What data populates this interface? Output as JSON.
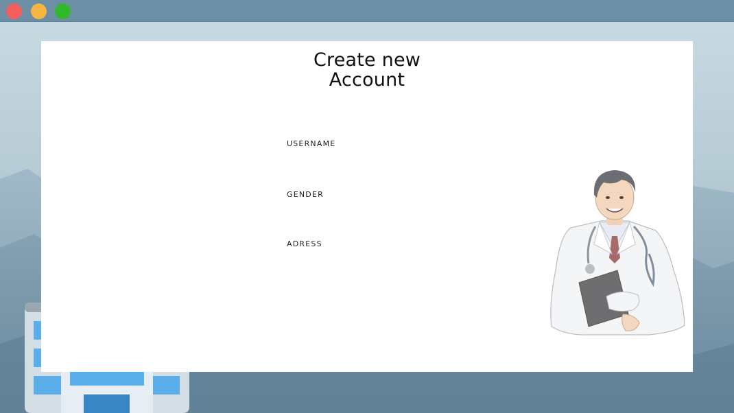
{
  "window": {
    "controls": [
      "close",
      "minimize",
      "maximize"
    ],
    "colors": {
      "close": "#f25f5c",
      "minimize": "#f7b543",
      "maximize": "#31b92d"
    }
  },
  "form": {
    "title_line1": "Create new",
    "title_line2": "Account",
    "fields": [
      {
        "label": "USERNAME",
        "value": ""
      },
      {
        "label": "GENDER",
        "value": ""
      },
      {
        "label": "ADRESS",
        "value": ""
      }
    ]
  },
  "illustrations": {
    "doctor": "doctor-illustration",
    "building": "hospital-building-illustration"
  }
}
